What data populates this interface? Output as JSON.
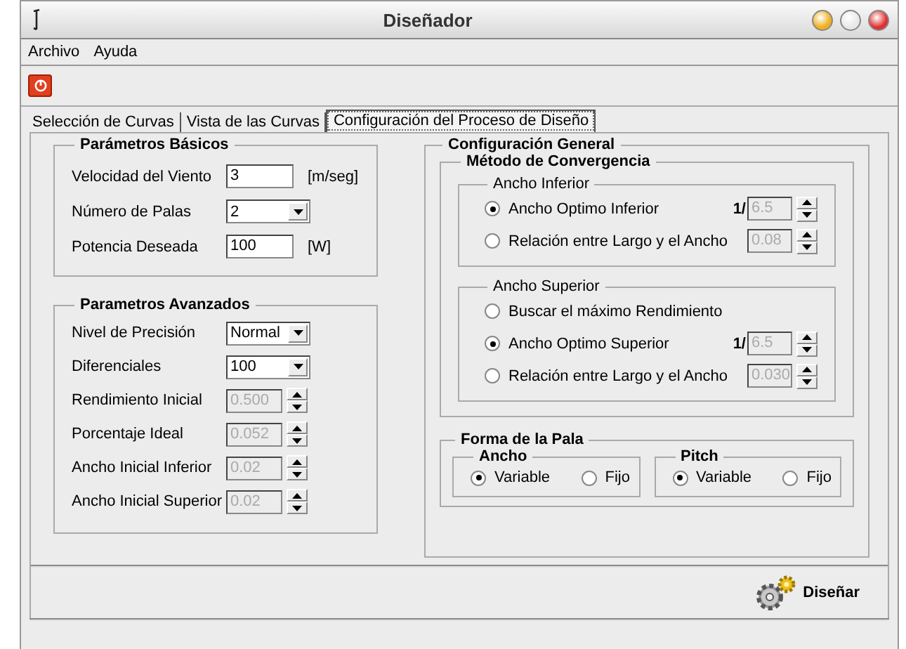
{
  "window": {
    "title": "Diseñador"
  },
  "menu": [
    "Archivo",
    "Ayuda"
  ],
  "tabs": [
    {
      "label": "Selección de Curvas",
      "selected": false
    },
    {
      "label": "Vista de las Curvas",
      "selected": false
    },
    {
      "label": "Configuración del Proceso de Diseño",
      "selected": true
    }
  ],
  "basic": {
    "title": "Parámetros Básicos",
    "fields": [
      {
        "kind": "text",
        "label": "Velocidad del Viento",
        "value": "3",
        "unit": "[m/seg]",
        "disabled": false
      },
      {
        "kind": "combo",
        "label": "Número de Palas",
        "value": "2",
        "disabled": false
      },
      {
        "kind": "text",
        "label": "Potencia Deseada",
        "value": "100",
        "unit": "[W]",
        "disabled": false
      }
    ]
  },
  "advanced": {
    "title": "Parametros Avanzados",
    "fields": [
      {
        "kind": "combo",
        "label": "Nivel de Precisión",
        "value": "Normal",
        "disabled": false
      },
      {
        "kind": "combo",
        "label": "Diferenciales",
        "value": "100",
        "disabled": false
      },
      {
        "kind": "spin",
        "label": "Rendimiento Inicial",
        "value": "0.500",
        "disabled": true
      },
      {
        "kind": "spin",
        "label": "Porcentaje Ideal",
        "value": "0.052",
        "disabled": true
      },
      {
        "kind": "spin",
        "label": "Ancho Inicial Inferior",
        "value": "0.02",
        "disabled": true
      },
      {
        "kind": "spin",
        "label": "Ancho Inicial Superior",
        "value": "0.02",
        "disabled": true
      }
    ]
  },
  "general": {
    "title": "Configuración General",
    "method": {
      "title": "Método de Convergencia",
      "groups": [
        {
          "title": "Ancho Inferior",
          "options": [
            {
              "label": "Ancho Optimo Inferior",
              "selected": true,
              "prefix": "1/",
              "value": "6.5",
              "disabled": true
            },
            {
              "label": "Relación entre Largo y el Ancho",
              "selected": false,
              "value": "0.08",
              "disabled": true
            }
          ]
        },
        {
          "title": "Ancho Superior",
          "options": [
            {
              "label": "Buscar el máximo Rendimiento",
              "selected": false
            },
            {
              "label": "Ancho Optimo Superior",
              "selected": true,
              "prefix": "1/",
              "value": "6.5",
              "disabled": true
            },
            {
              "label": "Relación entre Largo y el Ancho",
              "selected": false,
              "value": "0.030",
              "disabled": true
            }
          ]
        }
      ]
    },
    "shape": {
      "title": "Forma de la Pala",
      "groups": [
        {
          "title": "Ancho",
          "options": [
            {
              "label": "Variable",
              "selected": true
            },
            {
              "label": "Fijo",
              "selected": false
            }
          ]
        },
        {
          "title": "Pitch",
          "options": [
            {
              "label": "Variable",
              "selected": true
            },
            {
              "label": "Fijo",
              "selected": false
            }
          ]
        }
      ]
    }
  },
  "action": {
    "label": "Diseñar"
  }
}
